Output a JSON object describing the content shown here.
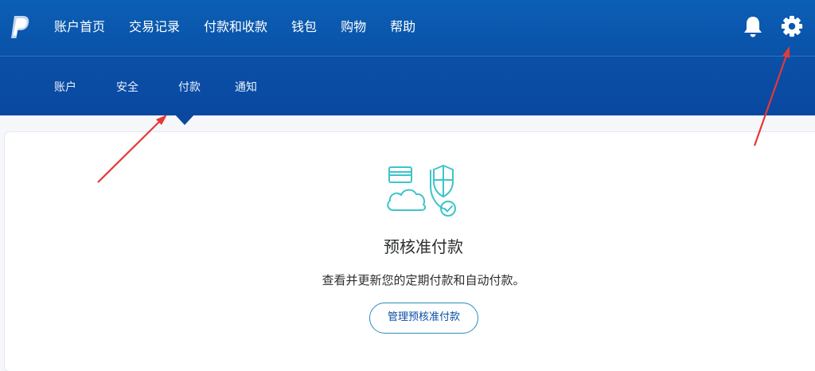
{
  "header": {
    "logo_icon": "paypal-logo-icon",
    "main_nav": [
      {
        "label": "账户首页"
      },
      {
        "label": "交易记录"
      },
      {
        "label": "付款和收款"
      },
      {
        "label": "钱包"
      },
      {
        "label": "购物"
      },
      {
        "label": "帮助"
      }
    ],
    "notifications_icon": "bell-icon",
    "settings_icon": "gear-icon"
  },
  "sub_nav": {
    "items": [
      {
        "label": "账户"
      },
      {
        "label": "安全"
      },
      {
        "label": "付款",
        "active": true
      },
      {
        "label": "通知"
      }
    ]
  },
  "content": {
    "illustration_icon": "card-cloud-shield-icon",
    "title": "预核准付款",
    "description": "查看并更新您的定期付款和自动付款。",
    "manage_button_label": "管理预核准付款"
  },
  "annotations": {
    "arrow_color": "#e53935",
    "arrows": [
      "points-to-payments-tab",
      "points-to-settings-gear"
    ]
  },
  "colors": {
    "header_blue": "#0a4ea6",
    "accent_teal": "#3cc5c9",
    "button_border": "#2a8fbd"
  }
}
